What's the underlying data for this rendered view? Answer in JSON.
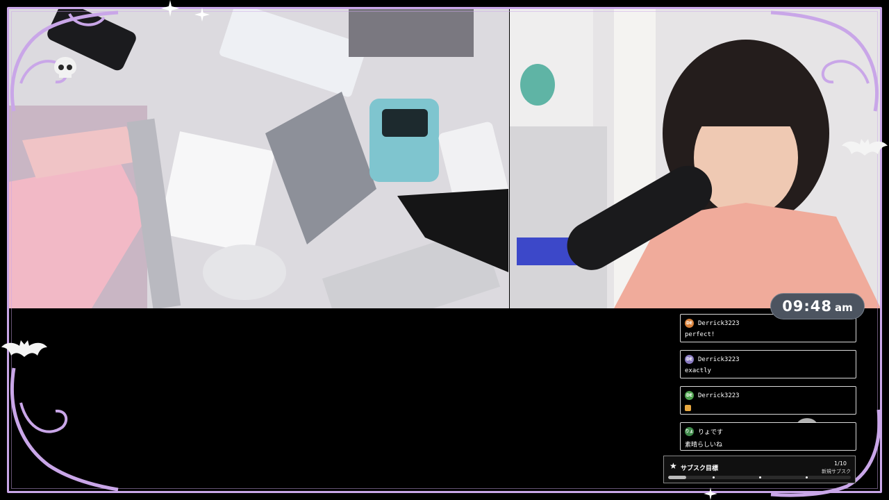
{
  "clock": {
    "time": "09:48",
    "ampm": "am"
  },
  "chat": {
    "messages": [
      {
        "avatar_text": "DE",
        "avatar_color": "#d9823b",
        "user": "Derrick3223",
        "text": "perfect!",
        "emote": false
      },
      {
        "avatar_text": "DE",
        "avatar_color": "#8a7cc2",
        "user": "Derrick3223",
        "text": "exactly",
        "emote": false
      },
      {
        "avatar_text": "DE",
        "avatar_color": "#4fa34f",
        "user": "Derrick3223",
        "text": "",
        "emote": true
      },
      {
        "avatar_text": "りょ",
        "avatar_color": "#3f8a4a",
        "user": "りょです",
        "text": "素晴らしいね",
        "emote": false
      }
    ]
  },
  "sub_goal": {
    "title": "サブスク目標",
    "count": "1/10",
    "subtitle": "新規サブスク",
    "progress": 0.1
  },
  "colors": {
    "frame": "#c9a6e8",
    "clock_bg": "#4c5460"
  },
  "icons": [
    "skull-icon",
    "bat-icon",
    "star-icon",
    "swirl-ornament-icon"
  ]
}
